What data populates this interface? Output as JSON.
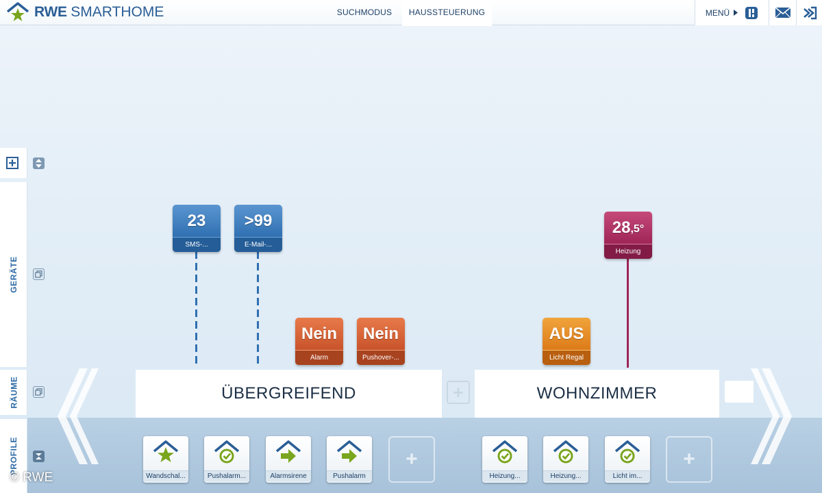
{
  "header": {
    "brand_bold": "RWE",
    "brand_light": "SMARTHOME",
    "tabs": [
      {
        "label": "SUCHMODUS",
        "active": false
      },
      {
        "label": "HAUSSTEUERUNG",
        "active": true
      }
    ],
    "menu_label": "MENÜ"
  },
  "sidebar": {
    "geraete_label": "GERÄTE",
    "raeume_label": "RÄUME",
    "profile_label": "PROFILE"
  },
  "tiles": [
    {
      "value": "23",
      "label": "SMS-...",
      "color": "blue"
    },
    {
      "value": ">99",
      "label": "E-Mail-...",
      "color": "blue"
    },
    {
      "value": "Nein",
      "label": "Alarm",
      "color": "orange"
    },
    {
      "value": "Nein",
      "label": "Pushover-...",
      "color": "orange"
    },
    {
      "value": "AUS",
      "label": "Licht Regal",
      "color": "amber"
    },
    {
      "value": "28",
      "value_sub": ",5°",
      "label": "Heizung",
      "color": "magenta"
    }
  ],
  "rooms": [
    {
      "name": "ÜBERGREIFEND"
    },
    {
      "name": "WOHNZIMMER"
    }
  ],
  "profiles": [
    {
      "label": "Wandschal...",
      "icon": "house-star-icon"
    },
    {
      "label": "Pushalarm...",
      "icon": "house-clock-icon"
    },
    {
      "label": "Alarmsirene",
      "icon": "house-arrow-icon"
    },
    {
      "label": "Pushalarm",
      "icon": "house-arrow-icon"
    },
    {
      "label": "Heizung...",
      "icon": "house-clock-icon"
    },
    {
      "label": "Heizung...",
      "icon": "house-clock-icon"
    },
    {
      "label": "Licht im...",
      "icon": "house-clock-icon"
    }
  ],
  "copyright": "© RWE",
  "colors": {
    "brand_blue": "#2a5e96",
    "brand_green": "#7aa51e",
    "tile_blue": "#2f6fb0",
    "tile_orange": "#c8522a",
    "tile_amber": "#db7a18",
    "tile_magenta": "#9e2456"
  }
}
